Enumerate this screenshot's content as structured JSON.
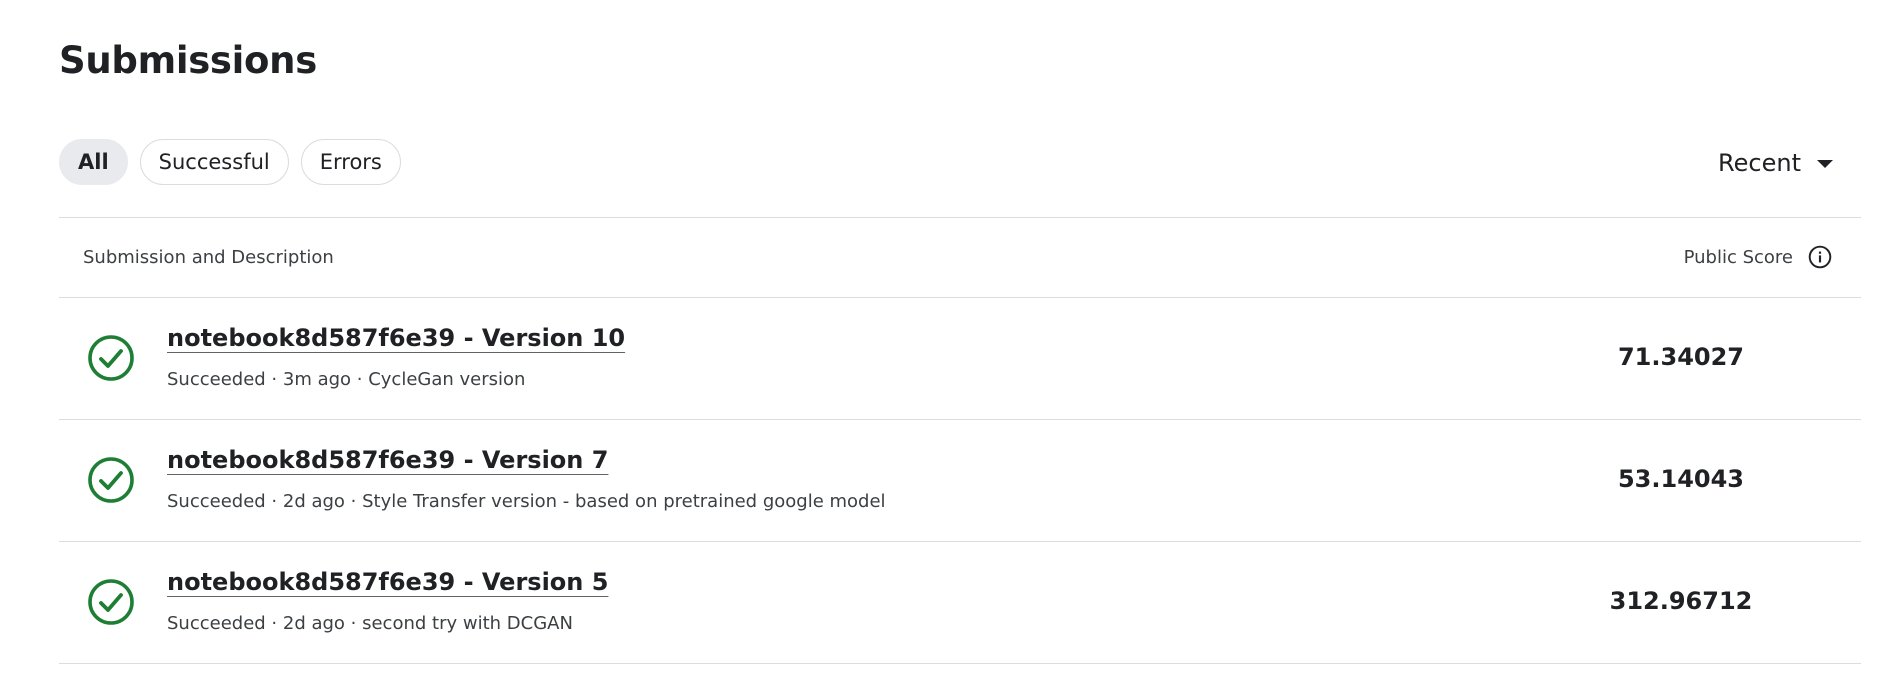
{
  "header": {
    "title": "Submissions"
  },
  "filters": [
    {
      "label": "All",
      "active": true
    },
    {
      "label": "Successful",
      "active": false
    },
    {
      "label": "Errors",
      "active": false
    }
  ],
  "sort": {
    "label": "Recent"
  },
  "table": {
    "col_left": "Submission and Description",
    "col_right": "Public Score",
    "rows": [
      {
        "title": "notebook8d587f6e39 - Version 10",
        "meta": "Succeeded · 3m ago · CycleGan version",
        "score": "71.34027"
      },
      {
        "title": "notebook8d587f6e39 - Version 7",
        "meta": "Succeeded · 2d ago · Style Transfer version - based on pretrained google model",
        "score": "53.14043"
      },
      {
        "title": "notebook8d587f6e39 - Version 5",
        "meta": "Succeeded · 2d ago · second try with DCGAN",
        "score": "312.96712"
      }
    ]
  },
  "colors": {
    "success": "#1e7e34",
    "text": "#202124",
    "border": "#dadce0",
    "chip_active_bg": "#e8eaed"
  },
  "icons": {
    "status": "check-circle-icon",
    "info": "info-icon",
    "sort": "caret-down-icon"
  }
}
